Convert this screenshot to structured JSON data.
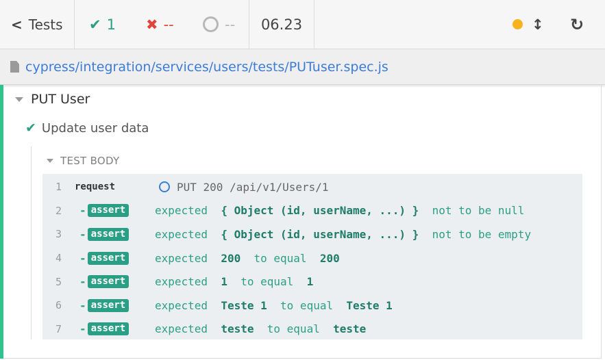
{
  "header": {
    "back_label": "Tests",
    "passed_count": "1",
    "failed_count": "--",
    "pending_count": "--",
    "duration": "06.23"
  },
  "spec": {
    "path": "cypress/integration/services/users/tests/PUTuser.spec.js"
  },
  "suite": {
    "title": "PUT User",
    "test": {
      "title": "Update user data",
      "state": "passed",
      "section_title": "TEST BODY",
      "commands": [
        {
          "num": "1",
          "name": "request",
          "message": "PUT 200 /api/v1/Users/1"
        },
        {
          "num": "2",
          "name": "assert",
          "parts": [
            "expected",
            "{ Object (id, userName, ...) }",
            "not to be null"
          ]
        },
        {
          "num": "3",
          "name": "assert",
          "parts": [
            "expected",
            "{ Object (id, userName, ...) }",
            "not to be empty"
          ]
        },
        {
          "num": "4",
          "name": "assert",
          "parts": [
            "expected",
            "200",
            "to equal",
            "200"
          ]
        },
        {
          "num": "5",
          "name": "assert",
          "parts": [
            "expected",
            "1",
            "to equal",
            "1"
          ]
        },
        {
          "num": "6",
          "name": "assert",
          "parts": [
            "expected",
            "Teste 1",
            "to equal",
            "Teste 1"
          ]
        },
        {
          "num": "7",
          "name": "assert",
          "parts": [
            "expected",
            "teste",
            "to equal",
            "teste"
          ]
        }
      ]
    }
  },
  "colors": {
    "passed": "#2b9f85",
    "failed": "#e2433a",
    "pending": "#b7b7b7",
    "running_dot": "#f6b31b",
    "link": "#3c7cd6"
  },
  "icons": [
    "chevron-left-icon",
    "check-icon",
    "x-icon",
    "ring-icon",
    "dot-icon",
    "resize-vertical-icon",
    "reload-icon",
    "file-icon",
    "caret-down-icon"
  ]
}
